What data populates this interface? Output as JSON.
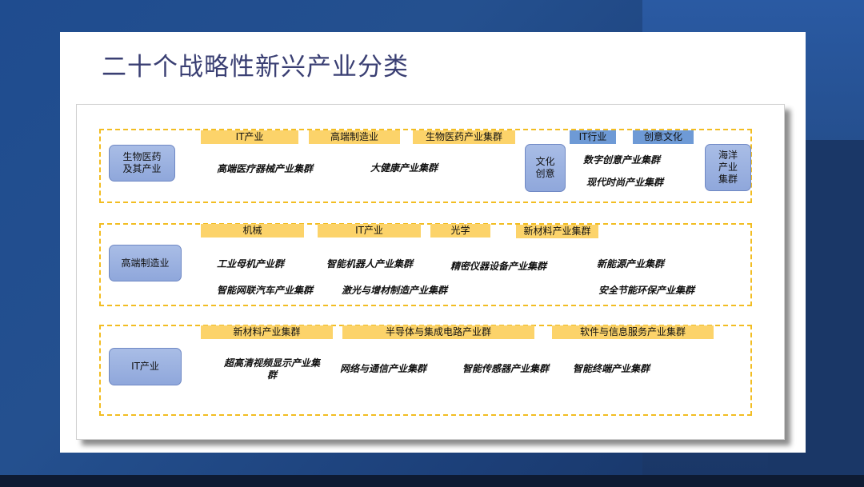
{
  "title": "二十个战略性新兴产业分类",
  "row1": {
    "category": "生物医药\n及其产业",
    "tags": [
      "IT产业",
      "高端制造业",
      "生物医药产业集群"
    ],
    "items": [
      "高端医疗器械产业集群",
      "大健康产业集群"
    ],
    "culture_node": "文化\n创意",
    "culture_tags": [
      "IT行业",
      "创意文化"
    ],
    "culture_items": [
      "数字创意产业集群",
      "现代时尚产业集群"
    ],
    "ocean_node": "海洋\n产业\n集群"
  },
  "row2": {
    "category": "高端制造业",
    "tags": [
      "机械",
      "IT产业",
      "光学",
      "新材料产业集群"
    ],
    "items": [
      "工业母机产业群",
      "智能机器人产业集群",
      "精密仪器设备产业集群",
      "新能源产业集群",
      "智能网联汽车产业集群",
      "激光与增材制造产业集群",
      "安全节能环保产业集群"
    ]
  },
  "row3": {
    "category": "IT产业",
    "tags": [
      "新材料产业集群",
      "半导体与集成电路产业群",
      "软件与信息服务产业集群"
    ],
    "items": [
      "超高清视频显示产业集群",
      "网络与通信产业集群",
      "智能传感器产业集群",
      "智能终端产业集群"
    ]
  },
  "colors": {
    "tag_yellow": "#fcd36a",
    "tag_blue": "#6e9ad6",
    "dash_border": "#f2bd22",
    "node_fill": "#a9bde6",
    "title": "#3a3f73"
  }
}
